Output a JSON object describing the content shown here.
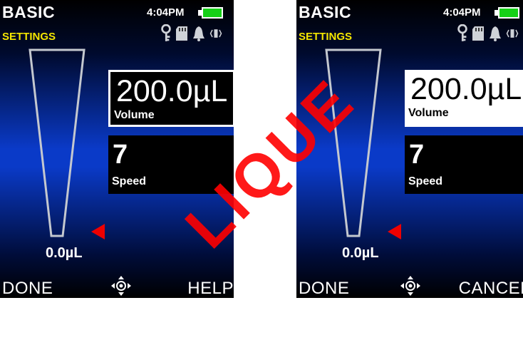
{
  "colors": {
    "accent_yellow": "#f5e600",
    "battery_green": "#16d016",
    "marker_red": "#ee0000",
    "watermark_red": "#ff0000"
  },
  "watermark": "LIQUE",
  "screens": [
    {
      "title": "BASIC",
      "subtitle": "SETTINGS",
      "time": "4:04PM",
      "status_icons": [
        "key-icon",
        "sd-card-icon",
        "bell-icon",
        "vibrate-icon"
      ],
      "volume": {
        "value": "200.0µL",
        "label": "Volume",
        "selected_style": "outlined"
      },
      "speed": {
        "value": "7",
        "label": "Speed"
      },
      "fill_value": "0.0µL",
      "softkeys": {
        "left": "DONE",
        "right": "HELP"
      },
      "nav_icon": "navigation-pad-icon"
    },
    {
      "title": "BASIC",
      "subtitle": "SETTINGS",
      "time": "4:04PM",
      "status_icons": [
        "key-icon",
        "sd-card-icon",
        "bell-icon",
        "vibrate-icon"
      ],
      "volume": {
        "value": "200.0µL",
        "label": "Volume",
        "selected_style": "inverted"
      },
      "speed": {
        "value": "7",
        "label": "Speed"
      },
      "fill_value": "0.0µL",
      "softkeys": {
        "left": "DONE",
        "right": "CANCEL"
      },
      "nav_icon": "navigation-pad-icon"
    }
  ]
}
